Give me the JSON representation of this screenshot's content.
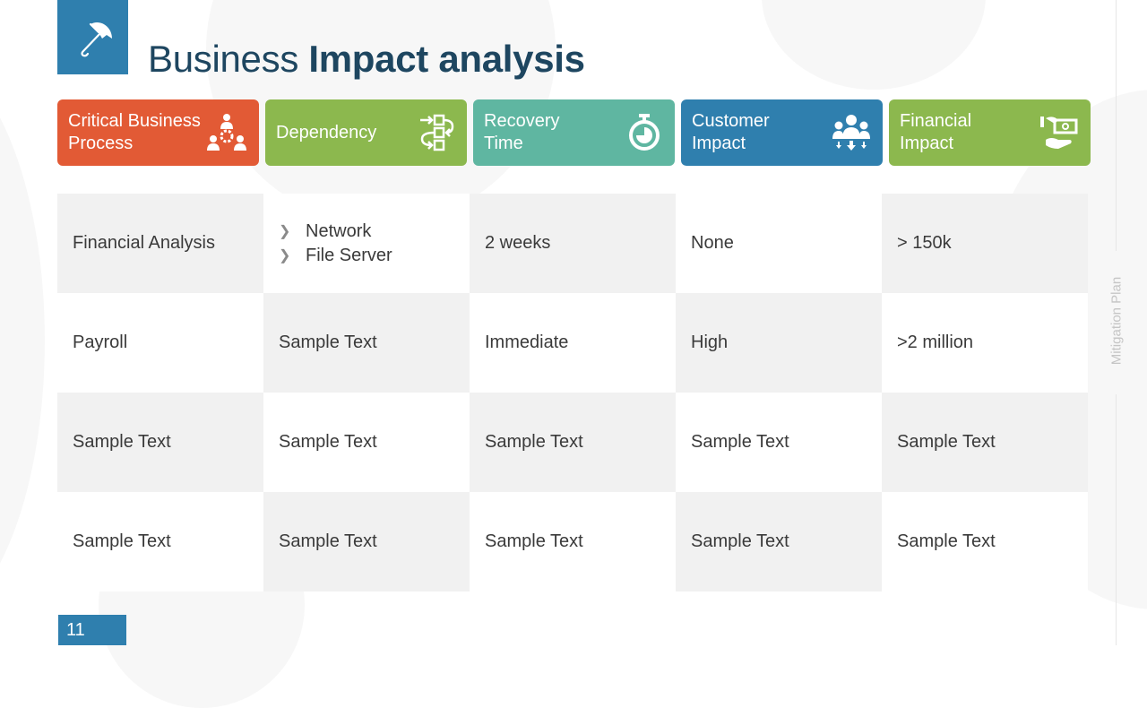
{
  "slide": {
    "title_regular": "Business ",
    "title_bold": "Impact analysis",
    "logo_icon": "umbrella-icon",
    "side_label": "Mitigation Plan",
    "page_number": "11"
  },
  "headers": [
    {
      "label": "Critical Business\nProcess",
      "icon": "team-gear-icon",
      "color": "#e25a35"
    },
    {
      "label": "Dependency",
      "icon": "flow-dependency-icon",
      "color": "#8cb84e"
    },
    {
      "label": "Recovery\nTime",
      "icon": "stopwatch-icon",
      "color": "#5fb6a1"
    },
    {
      "label": "Customer\nImpact",
      "icon": "customers-icon",
      "color": "#2f7fae"
    },
    {
      "label": "Financial\nImpact",
      "icon": "money-hand-icon",
      "color": "#8cb84e"
    }
  ],
  "rows": [
    {
      "process": "Financial Analysis",
      "dependency": [
        "Network",
        "File Server"
      ],
      "recovery": "2 weeks",
      "customer": "None",
      "financial": "> 150k"
    },
    {
      "process": "Payroll",
      "dependency": "Sample Text",
      "recovery": "Immediate",
      "customer": "High",
      "financial": ">2 million"
    },
    {
      "process": "Sample Text",
      "dependency": "Sample Text",
      "recovery": "Sample Text",
      "customer": "Sample Text",
      "financial": "Sample Text"
    },
    {
      "process": "Sample Text",
      "dependency": "Sample Text",
      "recovery": "Sample Text",
      "customer": "Sample Text",
      "financial": "Sample Text"
    }
  ]
}
